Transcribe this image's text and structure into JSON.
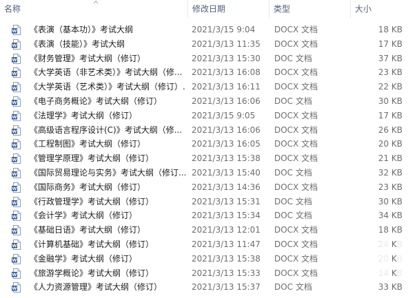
{
  "columns": {
    "name": "名称",
    "date": "修改日期",
    "type": "类型",
    "size": "大小"
  },
  "colors": {
    "header_text": "#4c607a",
    "word_icon": "#2b5797"
  },
  "files": [
    {
      "name": "《表演（基本功）》考试大纲",
      "date": "2021/3/15 9:04",
      "type": "DOCX 文档",
      "size": "18 KB"
    },
    {
      "name": "《表演（技能）》考试大纲",
      "date": "2021/3/13 11:35",
      "type": "DOCX 文档",
      "size": "17 KB"
    },
    {
      "name": "《财务管理》考试大纲（修订）",
      "date": "2021/3/13 15:30",
      "type": "DOC 文档",
      "size": "37 KB"
    },
    {
      "name": "《大学英语（非艺术类）》考试大纲（修...",
      "date": "2021/3/13 16:08",
      "type": "DOCX 文档",
      "size": "23 KB"
    },
    {
      "name": "《大学英语（艺术类）》考试大纲（修订）...",
      "date": "2021/3/13 16:11",
      "type": "DOCX 文档",
      "size": "22 KB"
    },
    {
      "name": "《电子商务概论》考试大纲（修订）",
      "date": "2021/3/13 16:06",
      "type": "DOC 文档",
      "size": "30 KB"
    },
    {
      "name": "《法理学》考试大纲（修订）",
      "date": "2021/3/15 9:05",
      "type": "DOCX 文档",
      "size": "17 KB"
    },
    {
      "name": "《高级语言程序设计(C)》考试大纲（修...",
      "date": "2021/3/13 16:06",
      "type": "DOCX 文档",
      "size": "26 KB"
    },
    {
      "name": "《工程制图》考试大纲（修订）",
      "date": "2021/3/13 16:05",
      "type": "DOCX 文档",
      "size": "20 KB"
    },
    {
      "name": "《管理学原理》考试大纲（修订）",
      "date": "2021/3/13 15:38",
      "type": "DOCX 文档",
      "size": "21 KB"
    },
    {
      "name": "《国际贸易理论与实务》考试大纲（修订...",
      "date": "2021/3/13 15:40",
      "type": "DOC 文档",
      "size": "32 KB"
    },
    {
      "name": "《国际商务》考试大纲（修订）",
      "date": "2021/3/13 14:36",
      "type": "DOCX 文档",
      "size": "23 KB"
    },
    {
      "name": "《行政管理学》考试大纲（修订）",
      "date": "2021/3/13 15:31",
      "type": "DOC 文档",
      "size": "30 KB"
    },
    {
      "name": "《会计学》考试大纲（修订）",
      "date": "2021/3/13 15:34",
      "type": "DOC 文档",
      "size": "34 KB"
    },
    {
      "name": "《基础日语》考试大纲（修订）",
      "date": "2021/3/13 12:01",
      "type": "DOCX 文档",
      "size": "18 KB"
    },
    {
      "name": "《计算机基础》考试大纲（修订）",
      "date": "2021/3/13 11:47",
      "type": "DOCX 文档",
      "size": "24 KB"
    },
    {
      "name": "《金融学》考试大纲（修订）",
      "date": "2021/3/13 15:38",
      "type": "DOCX 文档",
      "size": "20 KB"
    },
    {
      "name": "《旅游学概论》考试大纲（修订）",
      "date": "2021/3/13 15:33",
      "type": "DOCX 文档",
      "size": "14 KB"
    },
    {
      "name": "《人力资源管理》考试大纲（修订）",
      "date": "2021/3/13 15:37",
      "type": "DOC 文档",
      "size": "33 KB"
    }
  ]
}
